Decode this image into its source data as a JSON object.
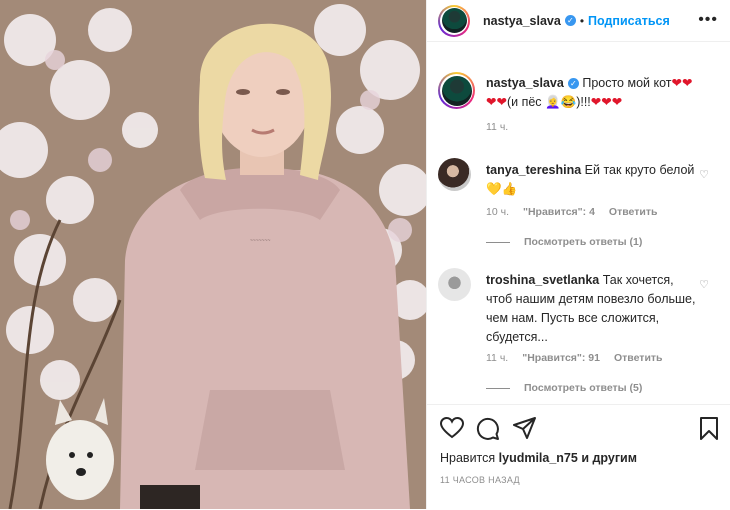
{
  "post": {
    "username": "nastya_slava",
    "follow_label": "Подписаться",
    "more_label": "•••",
    "dot": "•"
  },
  "caption": {
    "username": "nastya_slava",
    "text_line1": "Просто мой кот",
    "text_line2_a": "(и пёс",
    "text_line2_b": ")!!!",
    "heart": "❤",
    "time": "11 ч."
  },
  "comments": [
    {
      "username": "tanya_tereshina",
      "text": "Ей так круто белой",
      "emoji": "💛👍",
      "time": "10 ч.",
      "likes": "\"Нравится\": 4",
      "reply": "Ответить",
      "replies": "Посмотреть ответы (1)"
    },
    {
      "username": "troshina_svetlanka",
      "text": "Так хочется, чтоб нашим детям повезло больше, чем нам. Пусть все сложится, сбудется...",
      "time": "11 ч.",
      "likes": "\"Нравится\": 91",
      "reply": "Ответить",
      "replies": "Посмотреть ответы (5)"
    }
  ],
  "footer": {
    "likes_prefix": "Нравится ",
    "likes_user": "lyudmila_n75",
    "likes_suffix": " и другим",
    "timestamp": "11 ЧАСОВ НАЗАД"
  },
  "icons": [
    "heart-icon",
    "comment-icon",
    "share-icon",
    "bookmark-icon",
    "verified-icon",
    "more-icon"
  ]
}
